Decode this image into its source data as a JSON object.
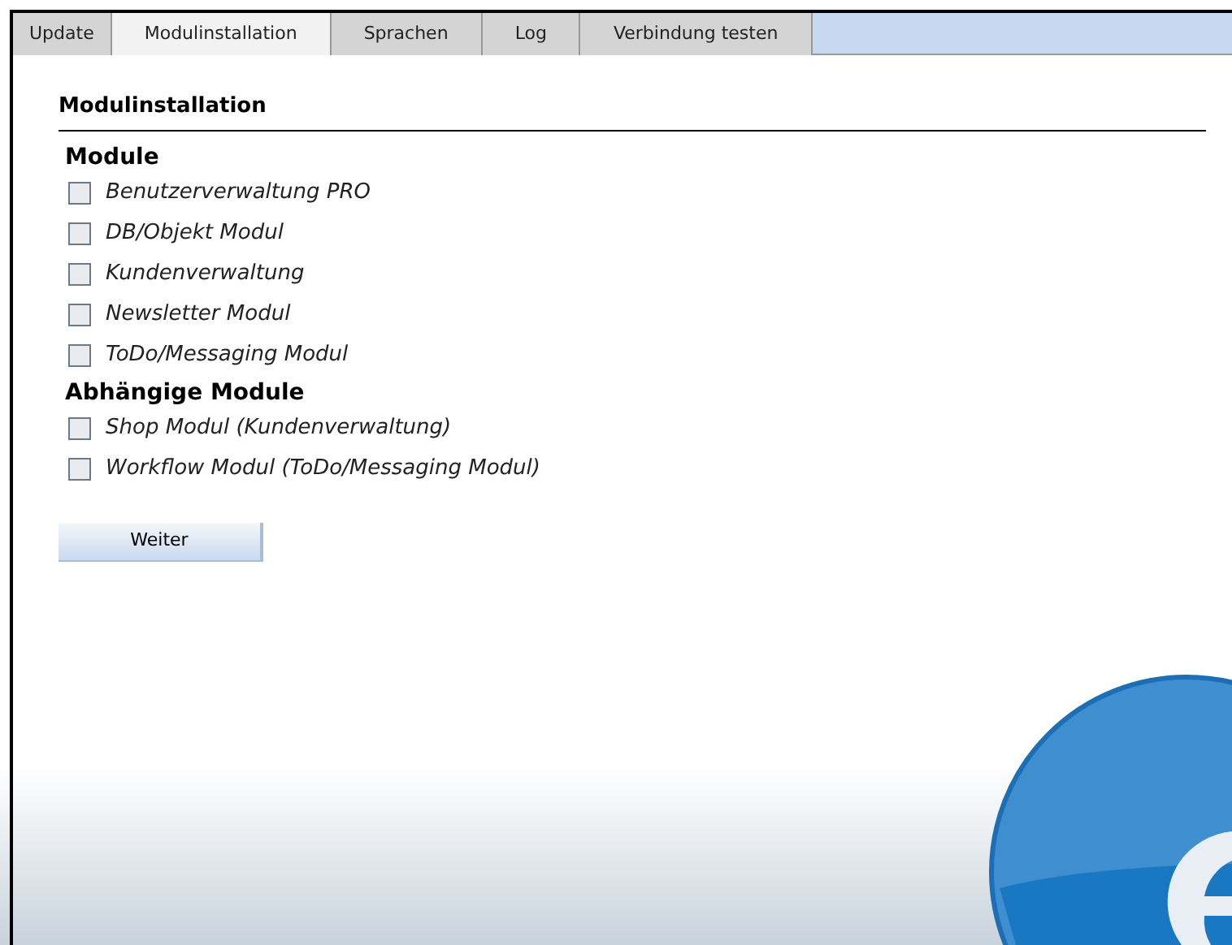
{
  "tabs": [
    {
      "label": "Update",
      "selected": false
    },
    {
      "label": "Modulinstallation",
      "selected": true
    },
    {
      "label": "Sprachen",
      "selected": false
    },
    {
      "label": "Log",
      "selected": false
    },
    {
      "label": "Verbindung testen",
      "selected": false
    }
  ],
  "heading": "Modulinstallation",
  "groups": [
    {
      "title": "Module",
      "items": [
        {
          "label": "Benutzerverwaltung PRO",
          "checked": false
        },
        {
          "label": "DB/Objekt Modul",
          "checked": false
        },
        {
          "label": "Kundenverwaltung",
          "checked": false
        },
        {
          "label": "Newsletter Modul",
          "checked": false
        },
        {
          "label": "ToDo/Messaging Modul",
          "checked": false
        }
      ]
    },
    {
      "title": "Abhängige Module",
      "items": [
        {
          "label": "Shop Modul (Kundenverwaltung)",
          "checked": false
        },
        {
          "label": "Workflow Modul (ToDo/Messaging Modul)",
          "checked": false
        }
      ]
    }
  ],
  "button": "Weiter"
}
